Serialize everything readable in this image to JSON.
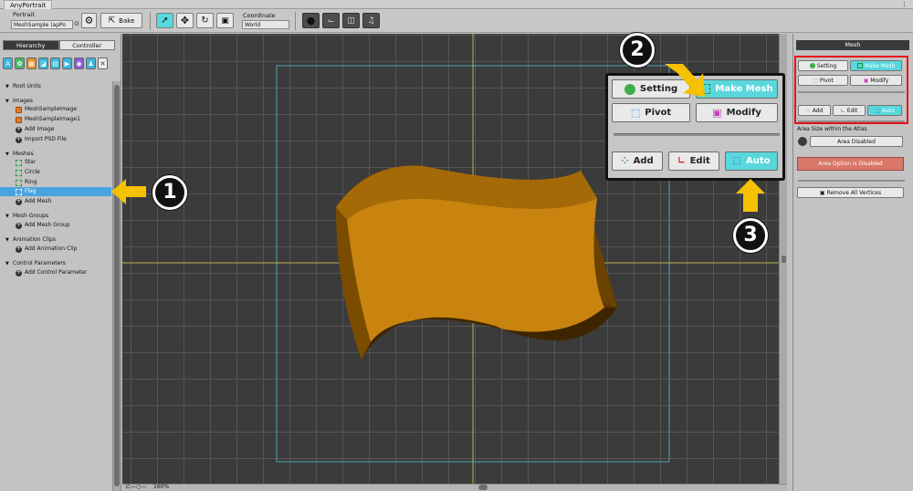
{
  "window": {
    "title": "AnyPortrait",
    "menu_icon": "menu-dots-icon"
  },
  "toolbar": {
    "portrait_label": "Portrait",
    "portrait_value": "MeshSample (apPo",
    "bake_label": "Bake",
    "coordinate_label": "Coordinate",
    "coordinate_value": "World"
  },
  "hierarchy": {
    "tabs": [
      {
        "label": "Hierarchy",
        "active": true
      },
      {
        "label": "Controller",
        "active": false
      }
    ],
    "sections": {
      "root_units": "Root Units",
      "images": "Images",
      "meshes": "Meshes",
      "mesh_groups": "Mesh Groups",
      "animation_clips": "Animation Clips",
      "control_parameters": "Control Parameters"
    },
    "images": [
      "MeshSampleImage",
      "MeshSampleImage1",
      "Add Image",
      "Import PSD File"
    ],
    "meshes": [
      "Star",
      "Circle",
      "Ring",
      "Flag",
      "Add Mesh"
    ],
    "selected_mesh": "Flag",
    "mesh_groups": [
      "Add Mesh Group"
    ],
    "animation_clips": [
      "Add Animation Clip"
    ],
    "control_parameters": [
      "Add Control Parameter"
    ]
  },
  "viewport": {
    "zoom": "160%"
  },
  "overlay": {
    "setting": "Setting",
    "make_mesh": "Make Mesh",
    "pivot": "Pivot",
    "modify": "Modify",
    "add": "Add",
    "edit": "Edit",
    "auto": "Auto"
  },
  "markers": [
    "1",
    "2",
    "3"
  ],
  "right_panel": {
    "header": "Mesh",
    "setting": "Setting",
    "make_mesh": "Make Mesh",
    "pivot": "Pivot",
    "modify": "Modify",
    "add": "Add",
    "edit": "Edit",
    "auto": "Auto",
    "area_label": "Area Size within the Atlas",
    "area_button": "Area Disabled",
    "area_warning": "Area Option is Disabled",
    "remove_all": "Remove All Vertices"
  },
  "colors": {
    "accent": "#5ad7dc",
    "selection": "#4aa3df",
    "highlight_box": "#e8101a",
    "arrow": "#f5c100",
    "flag": "#c8840e",
    "warning": "#d9776a"
  }
}
